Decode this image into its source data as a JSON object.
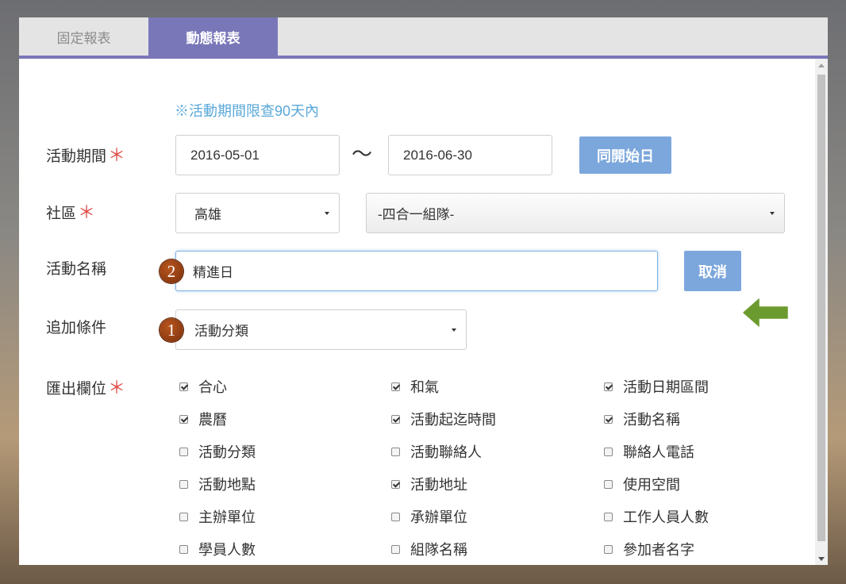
{
  "tabs": [
    {
      "label": "固定報表",
      "active": false
    },
    {
      "label": "動態報表",
      "active": true
    }
  ],
  "notice": "※活動期間限查90天內",
  "period": {
    "label": "活動期間",
    "required_mark": "＊",
    "start": "2016-05-01",
    "separator": "〜",
    "end": "2016-06-30",
    "same_day_button": "同開始日"
  },
  "community": {
    "label": "社區",
    "required_mark": "＊",
    "city": "高雄",
    "team": "-四合一組隊-"
  },
  "activity_name": {
    "label": "活動名稱",
    "value": "精進日",
    "cancel_button": "取消",
    "badge": "2"
  },
  "extra_condition": {
    "label": "追加條件",
    "value": "活動分類",
    "badge": "1"
  },
  "export_fields": {
    "label": "匯出欄位",
    "required_mark": "＊",
    "columns": [
      [
        {
          "label": "合心",
          "checked": true
        },
        {
          "label": "農曆",
          "checked": true
        },
        {
          "label": "活動分類",
          "checked": false
        },
        {
          "label": "活動地點",
          "checked": false
        },
        {
          "label": "主辦單位",
          "checked": false
        },
        {
          "label": "學員人數",
          "checked": false
        }
      ],
      [
        {
          "label": "和氣",
          "checked": true
        },
        {
          "label": "活動起迄時間",
          "checked": true
        },
        {
          "label": "活動聯絡人",
          "checked": false
        },
        {
          "label": "活動地址",
          "checked": true
        },
        {
          "label": "承辦單位",
          "checked": false
        },
        {
          "label": "組隊名稱",
          "checked": false
        }
      ],
      [
        {
          "label": "活動日期區間",
          "checked": true
        },
        {
          "label": "活動名稱",
          "checked": true
        },
        {
          "label": "聯絡人電話",
          "checked": false
        },
        {
          "label": "使用空間",
          "checked": false
        },
        {
          "label": "工作人員人數",
          "checked": false
        },
        {
          "label": "參加者名字",
          "checked": false
        }
      ]
    ]
  },
  "colors": {
    "tab_active": "#7a77b9",
    "button": "#7ca7dc",
    "notice": "#5aa8da",
    "required": "#e0504a",
    "arrow": "#6b9a2e",
    "badge": "#8b3a10"
  },
  "icons": {
    "callout_arrow": "arrow-left-icon",
    "dropdown": "caret-down-icon"
  }
}
